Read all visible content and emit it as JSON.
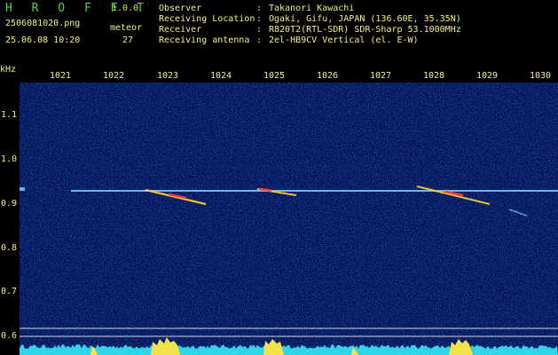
{
  "header": {
    "app_title": "H R O F F T",
    "app_version": "1.0.0",
    "file_name": "2506081020.png",
    "date_time": "25.06.08 10:20",
    "count_label": "meteor",
    "count_value": "27"
  },
  "station": [
    {
      "label": "Observer",
      "value": "Takanori Kawachi"
    },
    {
      "label": "Receiving Location",
      "value": "Ogaki, Gifu, JAPAN (136.60E, 35.35N)"
    },
    {
      "label": "Receiver",
      "value": "R820T2(RTL-SDR) SDR-Sharp 53.1000MHz"
    },
    {
      "label": "Receiving antenna",
      "value": "2el-HB9CV Vertical (el. E-W)"
    }
  ],
  "separator": ":",
  "axes": {
    "unit_label": "kHz",
    "x_ticks": [
      "1021",
      "1022",
      "1023",
      "1024",
      "1025",
      "1026",
      "1027",
      "1028",
      "1029",
      "1030"
    ],
    "y_ticks": [
      "1.1",
      "1.0",
      "0.9",
      "0.8",
      "0.7",
      "0.6"
    ]
  },
  "colors": {
    "background": "#000000",
    "spectrogram_bg": "#051457",
    "label_text": "#f3ef86",
    "title_green": "#4cd34c",
    "carrier_line": "#7fd0ff",
    "echo_hot": "#ff4040",
    "echo_warm": "#ffd23a",
    "power_cyan": "#2fd5e8",
    "power_yellow": "#f4e24a",
    "guide_line": "#d8d8d8"
  }
}
